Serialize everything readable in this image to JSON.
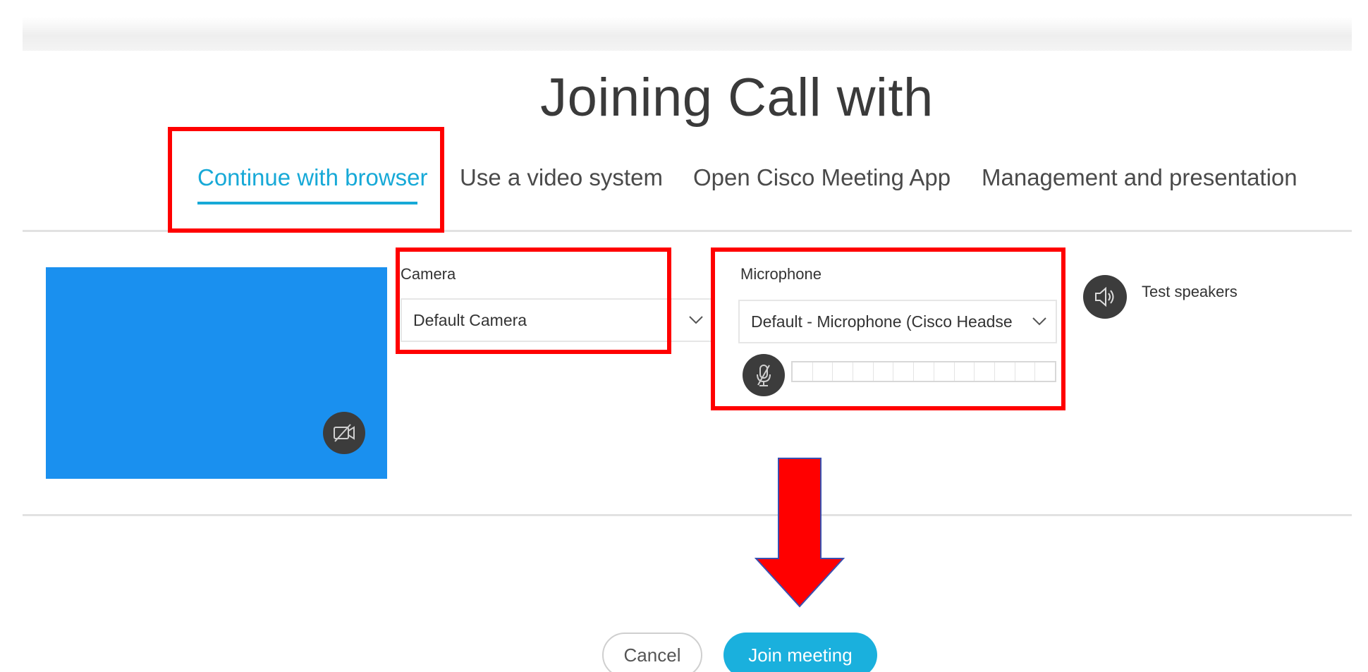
{
  "page": {
    "title": "Joining Call with"
  },
  "tabs": [
    {
      "label": "Continue with browser",
      "active": true
    },
    {
      "label": "Use a video system",
      "active": false
    },
    {
      "label": "Open Cisco Meeting App",
      "active": false
    },
    {
      "label": "Management and presentation",
      "active": false
    }
  ],
  "camera": {
    "label": "Camera",
    "selected": "Default Camera",
    "toggle_icon": "camera-off-icon"
  },
  "microphone": {
    "label": "Microphone",
    "selected": "Default - Microphone (Cisco Headse",
    "mute_icon": "microphone-muted-icon",
    "level_segments": 13,
    "level": 0
  },
  "speakers": {
    "label": "Test speakers",
    "icon": "speaker-icon"
  },
  "actions": {
    "cancel_label": "Cancel",
    "join_label": "Join meeting"
  },
  "colors": {
    "accent": "#17a9d7",
    "join_button": "#1ab0dd",
    "preview": "#1a90ef",
    "annotation": "#ff0000",
    "icon_button": "#3c3c3c"
  }
}
